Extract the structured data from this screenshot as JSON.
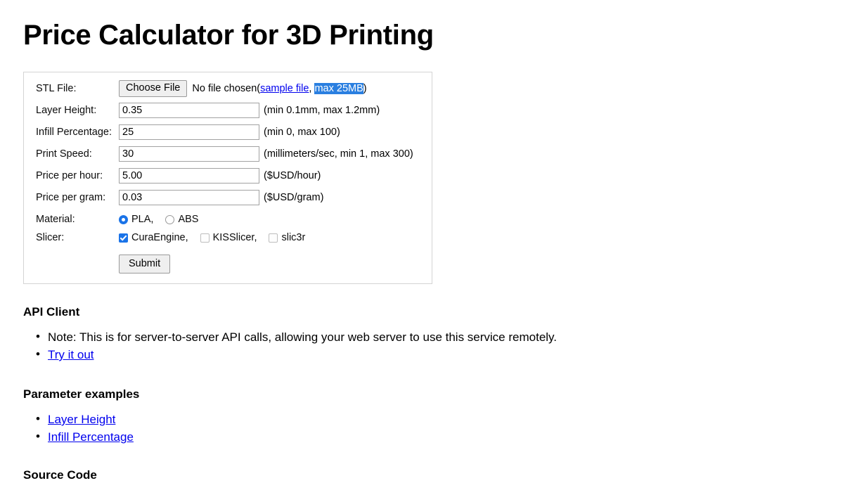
{
  "page": {
    "title": "Price Calculator for 3D Printing"
  },
  "form": {
    "file_row": {
      "label": "STL File:",
      "button_label": "Choose File",
      "status_prefix": "No file chosen(",
      "sample_link": "sample file",
      "comma": ", ",
      "max_size": "max 25MB",
      "status_suffix": ")"
    },
    "fields": [
      {
        "name": "layer-height",
        "label": "Layer Height:",
        "value": "0.35",
        "hint": "(min 0.1mm, max 1.2mm)"
      },
      {
        "name": "infill-percentage",
        "label": "Infill Percentage:",
        "value": "25",
        "hint": "(min 0, max 100)"
      },
      {
        "name": "print-speed",
        "label": "Print Speed:",
        "value": "30",
        "hint": "(millimeters/sec, min 1, max 300)"
      },
      {
        "name": "price-per-hour",
        "label": "Price per hour:",
        "value": "5.00",
        "hint": "($USD/hour)"
      },
      {
        "name": "price-per-gram",
        "label": "Price per gram:",
        "value": "0.03",
        "hint": "($USD/gram)"
      }
    ],
    "material": {
      "label": "Material:",
      "options": [
        {
          "label": "PLA,",
          "checked": true
        },
        {
          "label": "ABS",
          "checked": false
        }
      ]
    },
    "slicer": {
      "label": "Slicer:",
      "options": [
        {
          "label": "CuraEngine,",
          "checked": true
        },
        {
          "label": "KISSlicer,",
          "checked": false
        },
        {
          "label": "slic3r",
          "checked": false
        }
      ]
    },
    "submit_label": "Submit"
  },
  "sections": {
    "api_client": {
      "heading": "API Client",
      "items": [
        {
          "text": "Note: This is for server-to-server API calls, allowing your web server to use this service remotely.",
          "is_link": false
        },
        {
          "text": "Try it out",
          "is_link": true
        }
      ]
    },
    "parameter_examples": {
      "heading": "Parameter examples",
      "items": [
        {
          "text": "Layer Height",
          "is_link": true
        },
        {
          "text": "Infill Percentage",
          "is_link": true
        }
      ]
    },
    "source_code": {
      "heading": "Source Code"
    }
  },
  "colors": {
    "link": "#0000ee",
    "selection": "#2a7fe0",
    "control_accent": "#1a73e8"
  }
}
